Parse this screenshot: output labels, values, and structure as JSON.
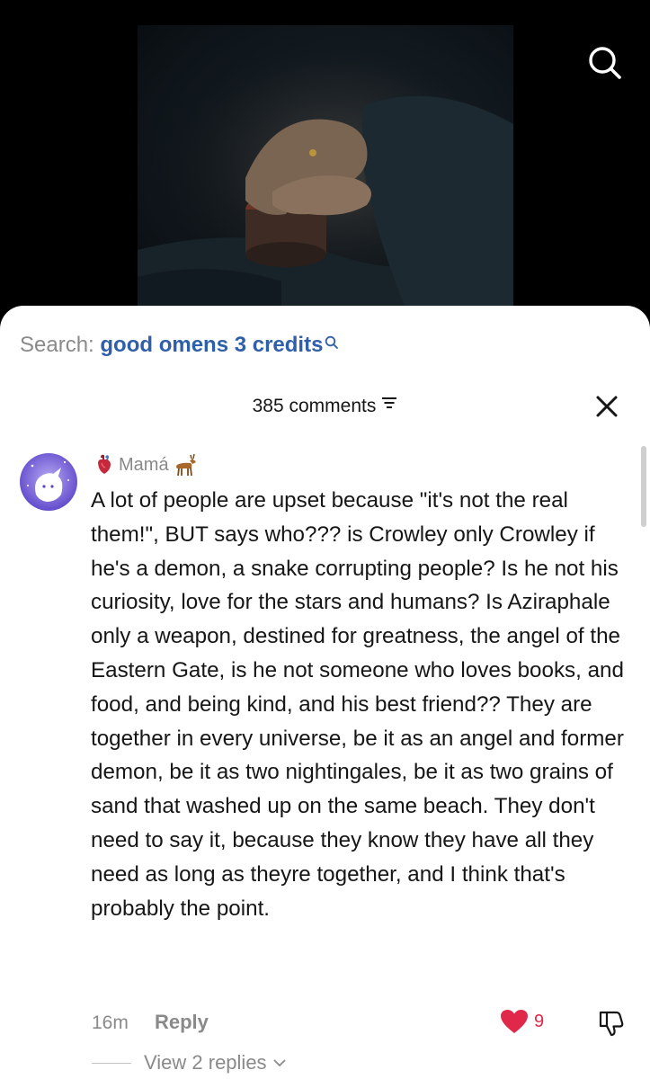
{
  "search": {
    "prefix": "Search:",
    "query": "good omens 3 credits"
  },
  "comments_header": {
    "count_label": "385 comments"
  },
  "comment": {
    "username": "Mamá",
    "text": "A lot of people are upset because \"it's not the real them!\", BUT says who??? is Crowley only Crowley if he's a demon, a snake corrupting people? Is he not his curiosity, love for the stars and humans? Is Aziraphale only a weapon, destined for greatness, the angel of the Eastern Gate, is he not someone who loves books, and food, and being kind, and his best friend?? They are together in every universe, be it as an angel and former demon, be it as two nightingales, be it as two grains of sand that washed up on the same beach. They don't need to say it, because they know they have all they need as long as theyre together, and I think that's probably the point.",
    "time": "16m",
    "reply_label": "Reply",
    "like_count": "9",
    "view_replies_label": "View 2 replies"
  },
  "colors": {
    "accent_link": "#2f5fa8",
    "like_red": "#e0294a",
    "muted_text": "#8a8a8a",
    "sheet_bg": "#ffffff"
  },
  "icons": {
    "top_search": "search-icon",
    "query_search": "search-icon",
    "filter": "filter-icon",
    "close": "close-icon",
    "user_left_badge": "anatomical-heart-emoji",
    "user_right_badge": "deer-emoji",
    "like": "heart-icon",
    "dislike": "thumbs-down-icon",
    "expand": "chevron-down-icon"
  }
}
